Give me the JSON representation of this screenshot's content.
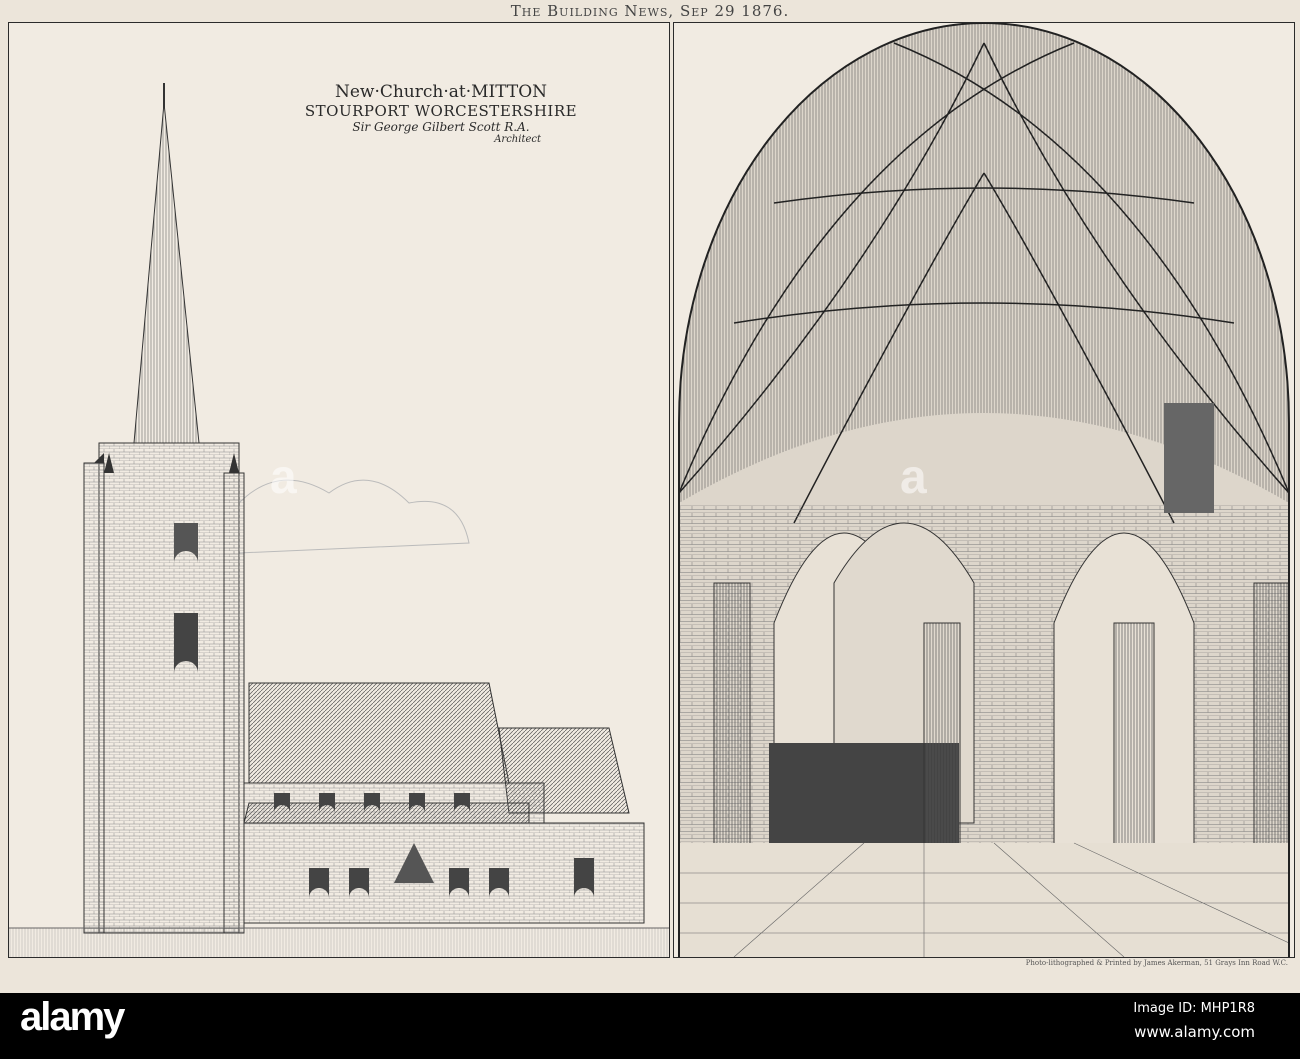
{
  "header": "The Building News, Sep 29 1876.",
  "left_plate": {
    "title_line1": "New·Church·at·MITTON",
    "title_line2": "STOURPORT WORCESTERSHIRE",
    "architect": "Sir George Gilbert Scott R.A.",
    "architect_role": "Architect"
  },
  "right_plate": {
    "printer_credit": "Photo-lithographed & Printed by James Akerman, 51 Grays Inn Road W.C."
  },
  "watermark": "alamy",
  "footer": {
    "logo": "alamy",
    "image_id": "Image ID: MHP1R8",
    "website": "www.alamy.com"
  },
  "colors": {
    "paper": "#ece5da",
    "ink": "#2b2b2b",
    "footer": "#000000"
  }
}
